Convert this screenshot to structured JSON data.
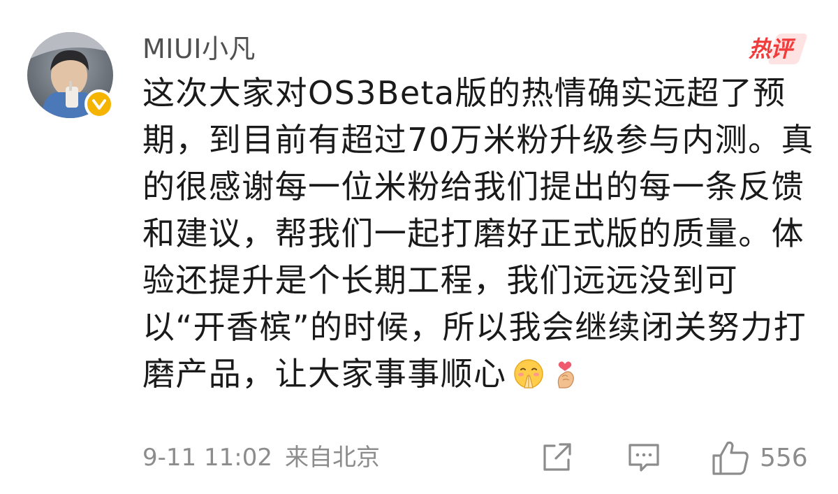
{
  "comment": {
    "username": "MIUI小凡",
    "hot_label": "热评",
    "text": "这次大家对OS3Beta版的热情确实远超了预期，到目前有超过70万米粉升级参与内测。真的很感谢每一位米粉给我们提出的每一条反馈和建议，帮我们一起打磨好正式版的质量。体验还提升是个长期工程，我们远远没到可以“开香槟”的时候，所以我会继续闭关努力打磨产品，让大家事事顺心",
    "emojis": [
      "pray-emoji",
      "finger-heart-emoji"
    ],
    "timestamp": "9-11 11:02",
    "location": "来自北京",
    "like_count": "556"
  },
  "colors": {
    "text": "#1a1a1a",
    "meta": "#8c8c8c",
    "hot": "#f23b3b",
    "verified": "#f5b400"
  }
}
